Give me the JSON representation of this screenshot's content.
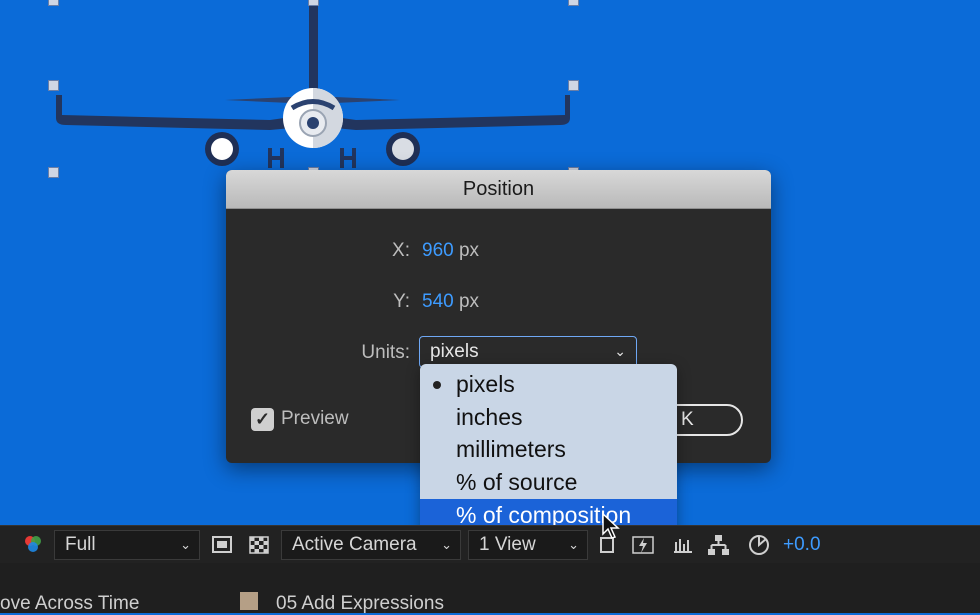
{
  "dialog": {
    "title": "Position",
    "x_label": "X:",
    "x_value": "960",
    "x_unit": "px",
    "y_label": "Y:",
    "y_value": "540",
    "y_unit": "px",
    "units_label": "Units:",
    "units_selected": "pixels",
    "preview_label": "Preview",
    "preview_checked": true,
    "ok_label": "K"
  },
  "units_menu": {
    "items": [
      {
        "label": "pixels",
        "checked": true
      },
      {
        "label": "inches"
      },
      {
        "label": "millimeters"
      },
      {
        "label": "% of source"
      },
      {
        "label": "% of composition",
        "highlighted": true
      }
    ]
  },
  "toolbar": {
    "resolution": "Full",
    "camera": "Active Camera",
    "views": "1 View",
    "exposure": "+0.0"
  },
  "timeline": {
    "layer_left": "ove Across Time",
    "layer_right": "05 Add Expressions"
  },
  "colors": {
    "canvas_bg": "#0b6bd8",
    "accent_value": "#3d9bff",
    "menu_highlight": "#1b63d8"
  }
}
